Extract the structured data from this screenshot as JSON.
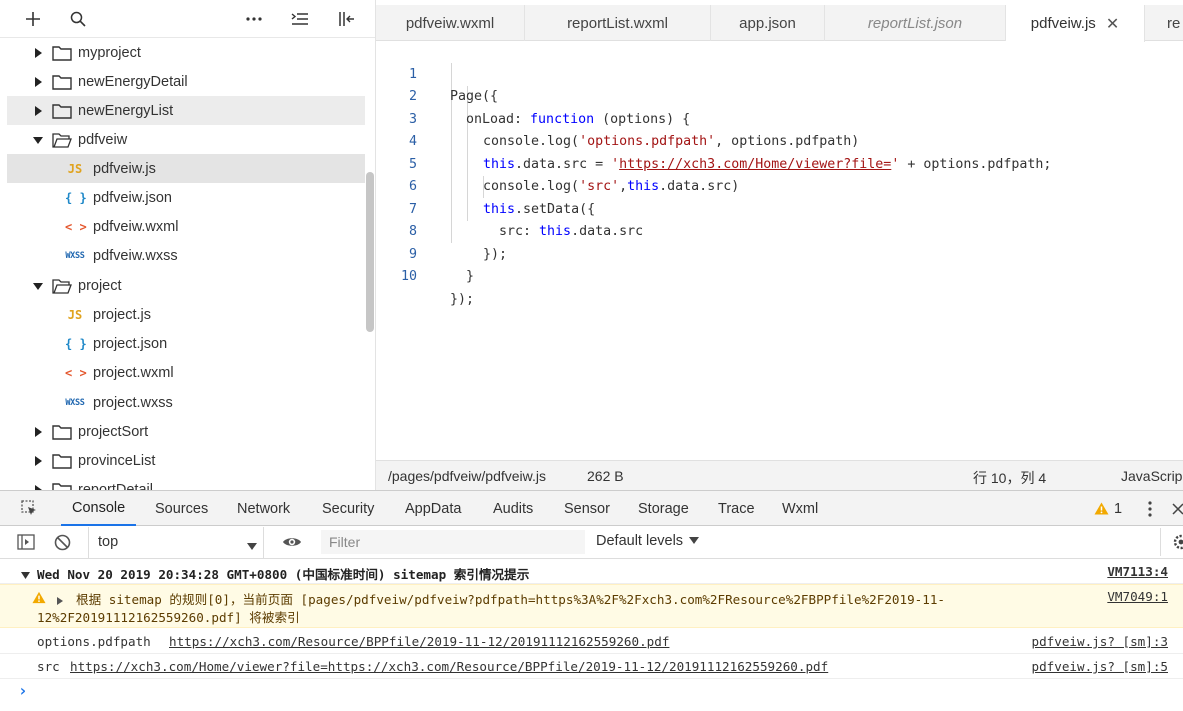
{
  "sidebar": {
    "toolbar": {
      "add_icon": "plus-icon",
      "search_icon": "search-icon",
      "more_icon": "more-icon",
      "collapse_icon": "collapse-all-icon",
      "split_icon": "split-pane-icon"
    },
    "tree": {
      "myproject": "myproject",
      "newEnergyDetail": "newEnergyDetail",
      "newEnergyList": "newEnergyList",
      "pdfveiw": "pdfveiw",
      "pdfveiw_js": "pdfveiw.js",
      "pdfveiw_json": "pdfveiw.json",
      "pdfveiw_wxml": "pdfveiw.wxml",
      "pdfveiw_wxss": "pdfveiw.wxss",
      "project": "project",
      "project_js": "project.js",
      "project_json": "project.json",
      "project_wxml": "project.wxml",
      "project_wxss": "project.wxss",
      "projectSort": "projectSort",
      "provinceList": "provinceList",
      "reportDetail": "reportDetail"
    },
    "icon_text": {
      "js": "JS",
      "json": "{ }",
      "wxml": "< >",
      "wxss": "WXSS"
    }
  },
  "editor": {
    "tabs": {
      "t1": "pdfveiw.wxml",
      "t2": "reportList.wxml",
      "t3": "app.json",
      "t4": "reportList.json",
      "t5": "pdfveiw.js",
      "t6": "re",
      "close": "✕"
    },
    "lines": {
      "n1": "1",
      "n2": "2",
      "n3": "3",
      "n4": "4",
      "n5": "5",
      "n6": "6",
      "n7": "7",
      "n8": "8",
      "n9": "9",
      "n10": "10"
    },
    "code": {
      "l1": "Page({",
      "l2_a": "onLoad: ",
      "l2_kw": "function",
      "l2_b": " (options) {",
      "l3_a": "console.log(",
      "l3_str": "'options.pdfpath'",
      "l3_b": ", options.pdfpath)",
      "l4_kw": "this",
      "l4_a": ".data.src = ",
      "l4_q1": "'",
      "l4_url": "https://xch3.com/Home/viewer?file=",
      "l4_q2": "'",
      "l4_b": " + options.pdfpath;",
      "l5_a": "console.log(",
      "l5_str": "'src'",
      "l5_b": ",",
      "l5_kw": "this",
      "l5_c": ".data.src)",
      "l6_kw": "this",
      "l6_a": ".setData({",
      "l7_a": "src: ",
      "l7_kw": "this",
      "l7_b": ".data.src",
      "l8": "});",
      "l9": "}",
      "l10": "});"
    },
    "status": {
      "path": "/pages/pdfveiw/pdfveiw.js",
      "size": "262 B",
      "cursor": "行 10，列 4",
      "language": "JavaScrip"
    }
  },
  "devtools": {
    "tabs": {
      "console": "Console",
      "sources": "Sources",
      "network": "Network",
      "security": "Security",
      "appdata": "AppData",
      "audits": "Audits",
      "sensor": "Sensor",
      "storage": "Storage",
      "trace": "Trace",
      "wxml": "Wxml"
    },
    "warning_count": "1",
    "toolbar": {
      "context": "top",
      "filter_placeholder": "Filter",
      "levels": "Default levels"
    },
    "console": {
      "group_title": "Wed Nov 20 2019 20:34:28 GMT+0800 (中国标准时间) sitemap 索引情况提示",
      "group_link": "VM7113:4",
      "warn_line1": "根据 sitemap 的规则[0]，当前页面 [pages/pdfveiw/pdfveiw?pdfpath=https%3A%2F%2Fxch3.com%2FResource%2FBPPfile%2F2019-11-",
      "warn_line2": "12%2F20191112162559260.pdf] 将被索引",
      "warn_link": "VM7049:1",
      "log1_label": "options.pdfpath",
      "log1_url": "https://xch3.com/Resource/BPPfile/2019-11-12/20191112162559260.pdf",
      "log1_link": "pdfveiw.js? [sm]:3",
      "log2_label": "src",
      "log2_url": "https://xch3.com/Home/viewer?file=https://xch3.com/Resource/BPPfile/2019-11-12/20191112162559260.pdf",
      "log2_link": "pdfveiw.js? [sm]:5",
      "prompt": "›"
    }
  },
  "colors": {
    "accent": "#1a73e8",
    "keyword": "#0000ff",
    "string": "#a31515",
    "warning_bg": "#fffbe5",
    "warning_icon": "#f2a900"
  }
}
